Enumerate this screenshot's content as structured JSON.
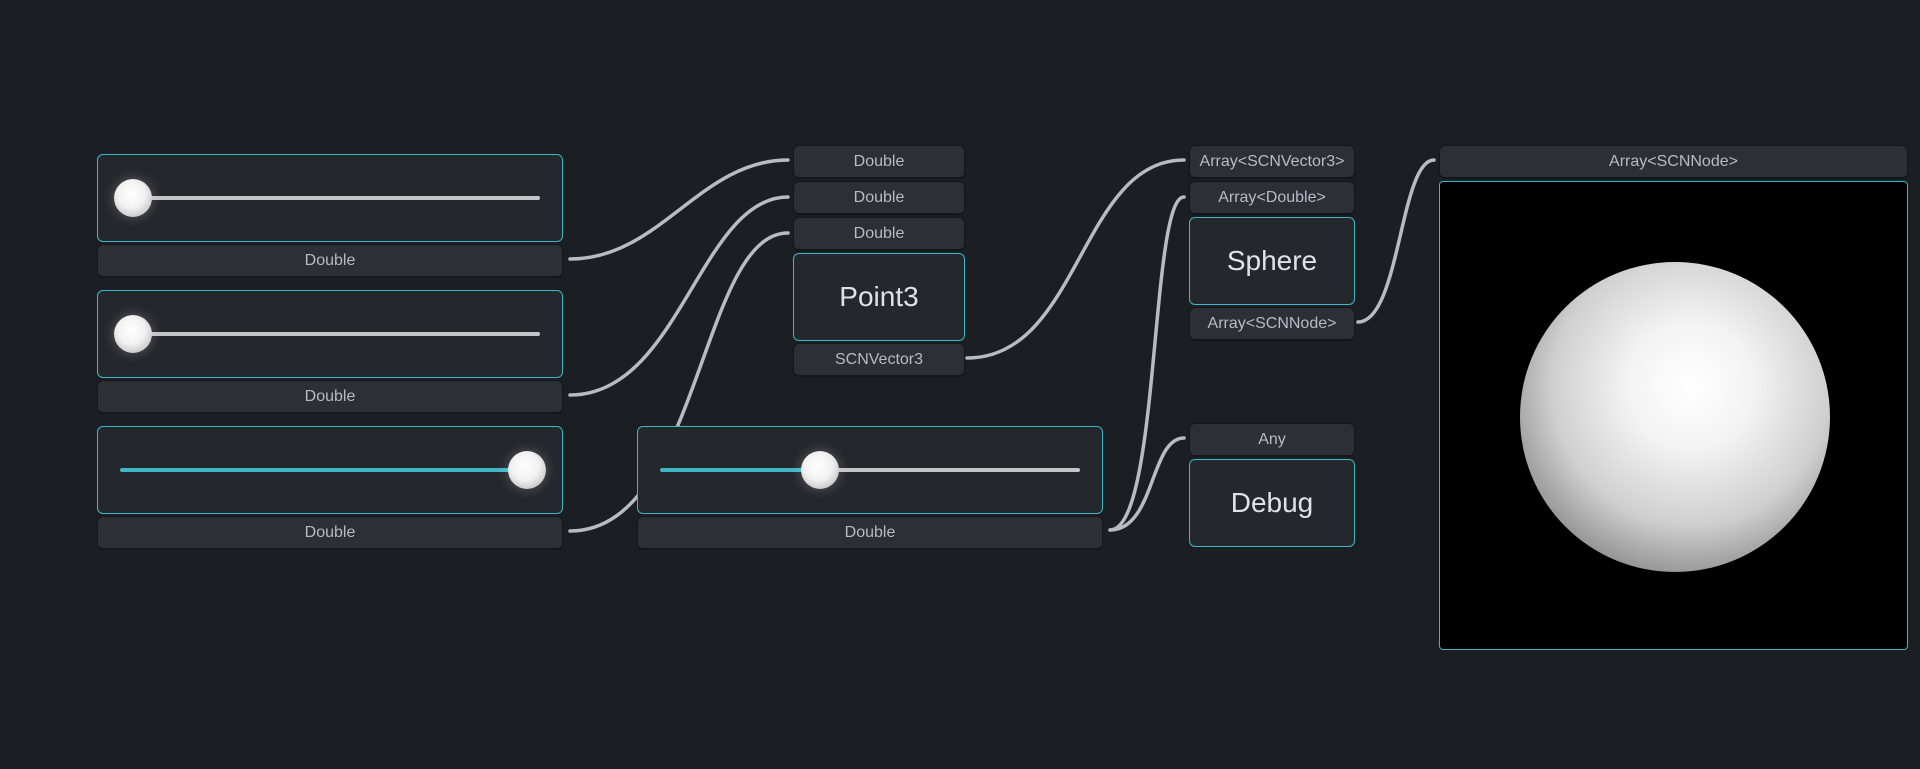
{
  "sliders": {
    "s1": {
      "output_label": "Double",
      "percent": 3
    },
    "s2": {
      "output_label": "Double",
      "percent": 3
    },
    "s3": {
      "output_label": "Double",
      "percent": 97
    },
    "s4": {
      "output_label": "Double",
      "percent": 38
    }
  },
  "point3": {
    "in1": "Double",
    "in2": "Double",
    "in3": "Double",
    "title": "Point3",
    "out": "SCNVector3"
  },
  "sphere": {
    "in1": "Array<SCNVector3>",
    "in2": "Array<Double>",
    "title": "Sphere",
    "out": "Array<SCNNode>"
  },
  "debug": {
    "in": "Any",
    "title": "Debug"
  },
  "render": {
    "in": "Array<SCNNode>"
  },
  "colors": {
    "accent": "#3fb6c7",
    "wire": "#b8bbc0",
    "bg": "#1b1e23"
  }
}
